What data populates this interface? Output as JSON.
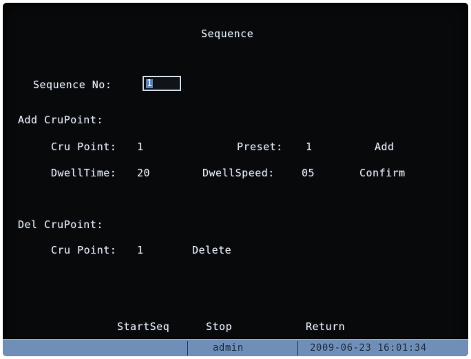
{
  "screen": {
    "title": "Sequence"
  },
  "sequence": {
    "label": "Sequence No:",
    "value": "1"
  },
  "add_section": {
    "heading": "Add CruPoint:",
    "cru_point_label": "Cru Point:",
    "cru_point_value": "1",
    "preset_label": "Preset:",
    "preset_value": "1",
    "add_label": "Add",
    "dwell_time_label": "DwellTime:",
    "dwell_time_value": "20",
    "dwell_speed_label": "DwellSpeed:",
    "dwell_speed_value": "05",
    "confirm_label": "Confirm"
  },
  "del_section": {
    "heading": "Del CruPoint:",
    "cru_point_label": "Cru Point:",
    "cru_point_value": "1",
    "delete_label": "Delete"
  },
  "actions": {
    "start_label": "StartSeq",
    "stop_label": "Stop",
    "return_label": "Return"
  },
  "status": {
    "user": "admin",
    "datetime": "2009-06-23 16:01:34"
  },
  "colors": {
    "background": "#07090b",
    "text": "#dfe6ec",
    "selection": "#5d7fb1",
    "statusbar": "#6f8fb8"
  }
}
